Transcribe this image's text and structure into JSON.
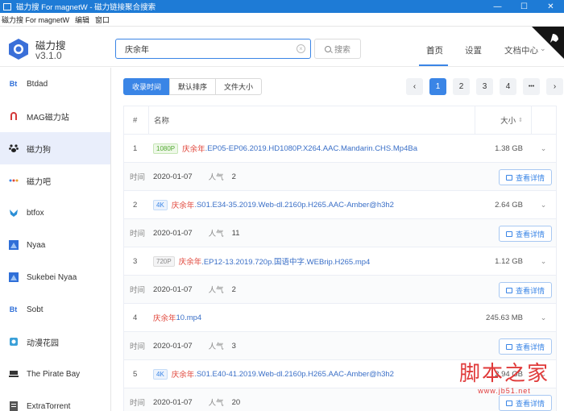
{
  "window": {
    "title": "磁力搜 For magnetW - 磁力链接聚合搜索",
    "minimize": "—",
    "maximize": "☐",
    "close": "✕"
  },
  "menu": {
    "items": [
      "磁力搜 For magnetW",
      "编辑",
      "窗口"
    ]
  },
  "brand": {
    "name": "磁力搜",
    "version": "v3.1.0"
  },
  "search": {
    "value": "庆余年",
    "button_label": "搜索"
  },
  "nav": {
    "tabs": [
      "首页",
      "设置",
      "文档中心"
    ],
    "active": "首页"
  },
  "sidebar": {
    "items": [
      {
        "label": "Btdad",
        "icon": "bt-icon",
        "color": "#2f6fd8"
      },
      {
        "label": "MAG磁力站",
        "icon": "magnet-icon",
        "color": "#d43a3a"
      },
      {
        "label": "磁力狗",
        "icon": "dog-paw-icon",
        "color": "#222222"
      },
      {
        "label": "磁力吧",
        "icon": "dots-icon",
        "color": "#e06b2a"
      },
      {
        "label": "btfox",
        "icon": "fox-icon",
        "color": "#2b8fd6"
      },
      {
        "label": "Nyaa",
        "icon": "nyaa-icon",
        "color": "#2f6fd8"
      },
      {
        "label": "Sukebei Nyaa",
        "icon": "nyaa-icon",
        "color": "#2f6fd8"
      },
      {
        "label": "Sobt",
        "icon": "bt-icon",
        "color": "#2f6fd8"
      },
      {
        "label": "动漫花园",
        "icon": "flower-icon",
        "color": "#3aa0d8"
      },
      {
        "label": "The Pirate Bay",
        "icon": "ship-icon",
        "color": "#333333"
      },
      {
        "label": "ExtraTorrent",
        "icon": "doc-icon",
        "color": "#555555"
      }
    ],
    "active_index": 2
  },
  "sort": {
    "buttons": [
      "收录时间",
      "默认排序",
      "文件大小"
    ],
    "active": "收录时间"
  },
  "pager": {
    "prev": "‹",
    "pages": [
      "1",
      "2",
      "3",
      "4"
    ],
    "more": "•••",
    "next": "›",
    "current": "1"
  },
  "table": {
    "headers": {
      "num": "#",
      "name": "名称",
      "size": "大小"
    },
    "detail_labels": {
      "time": "时间",
      "popularity": "人气",
      "button": "查看详情"
    },
    "rows": [
      {
        "num": "1",
        "tag": "1080P",
        "tag_style": "green",
        "keyword": "庆余年",
        "rest": ".EP05-EP06.2019.HD1080P.X264.AAC.Mandarin.CHS.Mp4Ba",
        "size": "1.38 GB",
        "date": "2020-01-07",
        "popularity": "2"
      },
      {
        "num": "2",
        "tag": "4K",
        "tag_style": "blue",
        "keyword": "庆余年",
        "rest": ".S01.E34-35.2019.Web-dl.2160p.H265.AAC-Amber@h3h2",
        "size": "2.64 GB",
        "date": "2020-01-07",
        "popularity": "11"
      },
      {
        "num": "3",
        "tag": "720P",
        "tag_style": "gray",
        "keyword": "庆余年",
        "rest": ".EP12-13.2019.720p.国语中字.WEBrip.H265.mp4",
        "size": "1.12 GB",
        "date": "2020-01-07",
        "popularity": "2"
      },
      {
        "num": "4",
        "tag": "",
        "tag_style": "",
        "keyword": "庆余年",
        "rest": "10.mp4",
        "size": "245.63 MB",
        "date": "2020-01-07",
        "popularity": "3"
      },
      {
        "num": "5",
        "tag": "4K",
        "tag_style": "blue",
        "keyword": "庆余年",
        "rest": ".S01.E40-41.2019.Web-dl.2160p.H265.AAC-Amber@h3h2",
        "size": "2.94 GB",
        "date": "2020-01-07",
        "popularity": "20"
      }
    ]
  },
  "watermark": {
    "main": "脚本之家",
    "sub": "www.jb51.net"
  },
  "colors": {
    "accent": "#3a85e6",
    "titlebar": "#1e7bd6",
    "highlight": "#e0453a"
  }
}
